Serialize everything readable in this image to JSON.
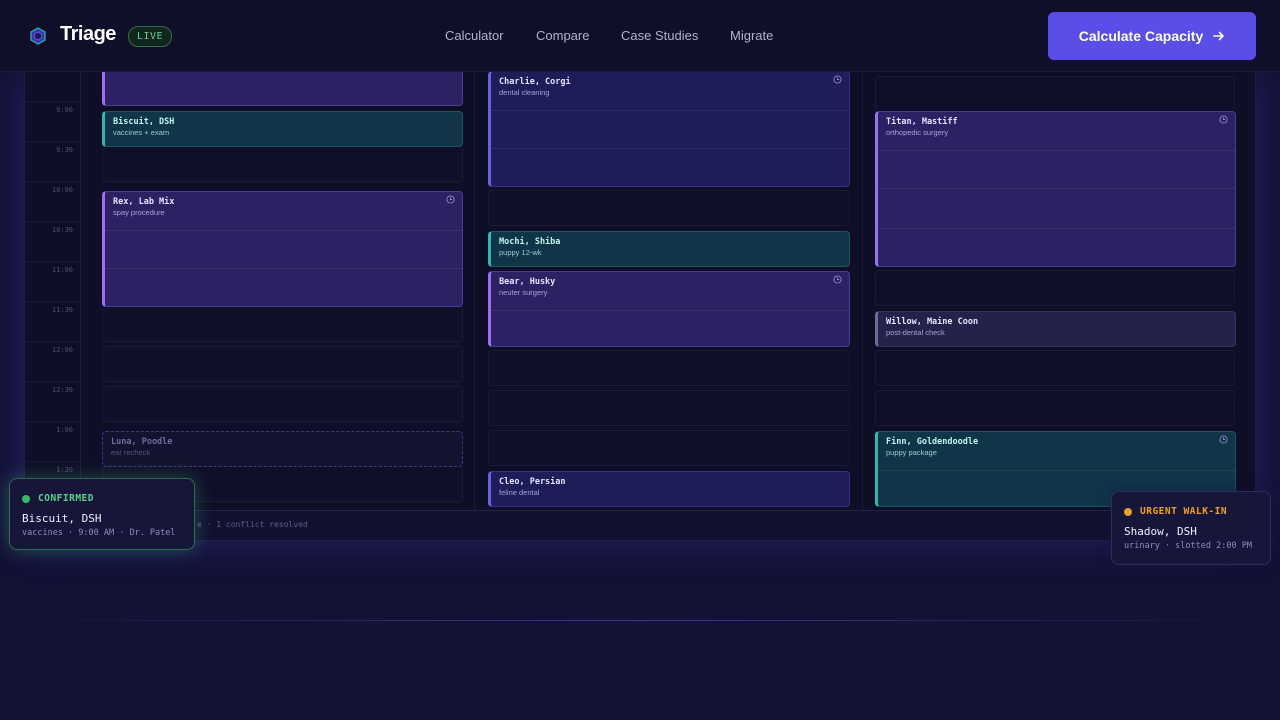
{
  "brand": {
    "name": "Triage",
    "badge": "LIVE"
  },
  "nav": {
    "items": [
      "Calculator",
      "Compare",
      "Case Studies",
      "Migrate"
    ]
  },
  "cta": {
    "label": "Calculate Capacity",
    "icon": "arrow-right-icon"
  },
  "schedule": {
    "times": [
      "",
      "9:00",
      "9:30",
      "10:00",
      "10:30",
      "11:00",
      "11:30",
      "12:00",
      "12:30",
      "1:00",
      "1:30"
    ],
    "columns": [
      {
        "appointments": [
          {
            "name": "",
            "desc": ""
          },
          {
            "name": "Biscuit, DSH",
            "desc": "vaccines + exam"
          },
          {
            "name": "Rex, Lab Mix",
            "desc": "spay procedure"
          },
          {
            "name": "Luna, Poodle",
            "desc": "ear recheck"
          }
        ]
      },
      {
        "appointments": [
          {
            "name": "Charlie, Corgi",
            "desc": "dental cleaning"
          },
          {
            "name": "Mochi, Shiba",
            "desc": "puppy 12-wk"
          },
          {
            "name": "Bear, Husky",
            "desc": "neuter surgery"
          },
          {
            "name": "Cleo, Persian",
            "desc": "feline dental"
          }
        ]
      },
      {
        "appointments": [
          {
            "name": "Titan, Mastiff",
            "desc": "orthopedic surgery"
          },
          {
            "name": "Willow, Maine Coon",
            "desc": "post-dental check"
          },
          {
            "name": "Finn, Goldendoodle",
            "desc": "puppy package"
          }
        ]
      }
    ],
    "status_text": "e · 1 conflict resolved"
  },
  "cards": {
    "confirmed": {
      "title": "CONFIRMED",
      "name": "Biscuit, DSH",
      "meta": "vaccines · 9:00 AM · Dr. Patel"
    },
    "urgent": {
      "title": "URGENT WALK-IN",
      "name": "Shadow, DSH",
      "meta": "urinary · slotted 2:00 PM"
    }
  },
  "colors": {
    "accent": "#5b4ee8",
    "live": "#5fd08f",
    "confirmed": "#2fbf6a",
    "urgent": "#f0a020",
    "purple": "#9a6ff2",
    "teal": "#2fb9a8"
  }
}
